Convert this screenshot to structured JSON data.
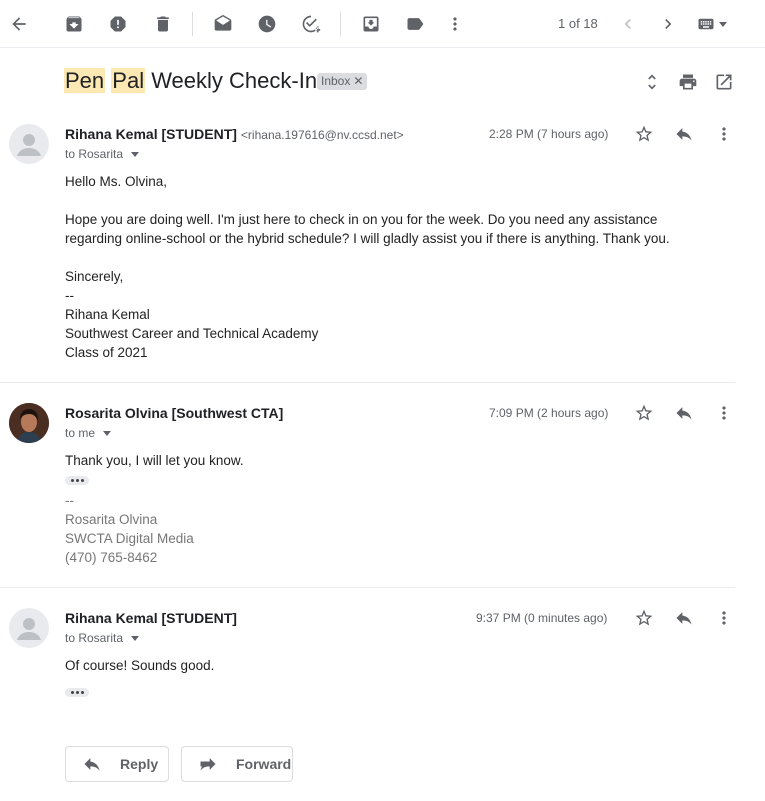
{
  "toolbar": {
    "counter": "1 of 18"
  },
  "thread": {
    "subject_parts": [
      {
        "text": "Pen",
        "highlight": true
      },
      {
        "text": " "
      },
      {
        "text": "Pal",
        "highlight": true
      },
      {
        "text": " Weekly Check-In"
      }
    ],
    "label": "Inbox"
  },
  "messages": [
    {
      "sender": "Rihana Kemal [STUDENT]",
      "email": "<rihana.197616@nv.ccsd.net>",
      "to": "to Rosarita",
      "time": "2:28 PM (7 hours ago)",
      "body": [
        "Hello Ms. Olvina,",
        "",
        "Hope you are doing well. I'm just here to check in on you for the week. Do you need any assistance regarding online-school or the hybrid schedule? I will gladly assist you if there is anything. Thank you.",
        "",
        "Sincerely,",
        "--",
        "Rihana Kemal",
        "Southwest Career and Technical Academy",
        "Class of 2021"
      ]
    },
    {
      "sender": "Rosarita Olvina [Southwest CTA]",
      "to": "to me",
      "time": "7:09 PM (2 hours ago)",
      "body": [
        "Thank you, I will let you know."
      ],
      "signature": [
        "--",
        "Rosarita Olvina",
        "SWCTA Digital Media",
        "(470) 765-8462"
      ]
    },
    {
      "sender": "Rihana Kemal [STUDENT]",
      "to": "to Rosarita",
      "time": "9:37 PM (0 minutes ago)",
      "body": [
        "Of course! Sounds good."
      ]
    }
  ],
  "actions": {
    "reply": "Reply",
    "forward": "Forward"
  },
  "icons": [
    "back-arrow-icon",
    "archive-icon",
    "report-spam-icon",
    "delete-icon",
    "mark-unread-icon",
    "snooze-icon",
    "add-to-tasks-icon",
    "move-to-icon",
    "label-icon",
    "more-vert-icon",
    "chevron-left-icon",
    "chevron-right-icon",
    "keyboard-icon",
    "expand-all-icon",
    "print-icon",
    "open-new-window-icon",
    "star-icon",
    "reply-icon"
  ]
}
